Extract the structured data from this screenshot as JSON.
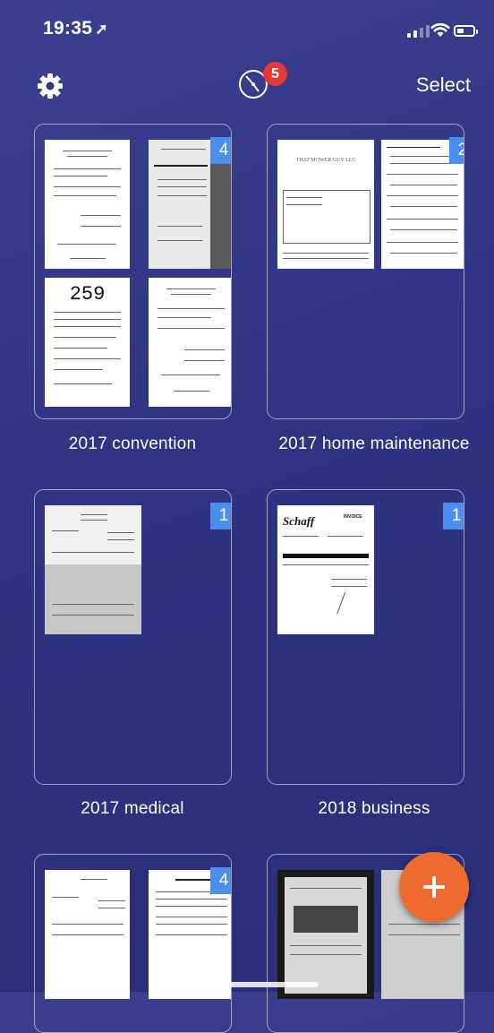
{
  "status_bar": {
    "time": "19:35",
    "location_glyph": "➚"
  },
  "nav": {
    "select_label": "Select",
    "sync_badge_count": "5",
    "icons": [
      "gear-icon",
      "sync-icon"
    ]
  },
  "folders": [
    {
      "name": "2017 convention",
      "count": "4",
      "receipt_number": "259"
    },
    {
      "name": "2017 home maintenance",
      "count": "2",
      "doc_title": "THAT MOWER GUY LLC"
    },
    {
      "name": "2017 medical",
      "count": "1"
    },
    {
      "name": "2018 business",
      "count": "1",
      "doc_brand": "Schaff",
      "doc_heading": "INVOICE"
    },
    {
      "name": "",
      "count": "4"
    },
    {
      "name": "",
      "count": ""
    }
  ],
  "fab": {
    "label": "+"
  }
}
